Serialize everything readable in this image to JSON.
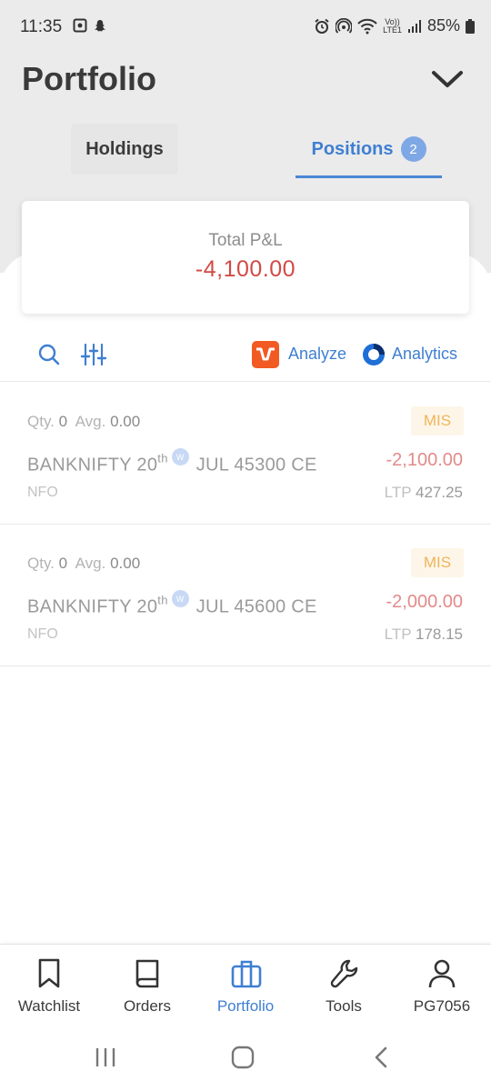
{
  "status_bar": {
    "time": "11:35",
    "battery": "85%",
    "network": "LTE1",
    "network_prefix": "Vo))"
  },
  "header": {
    "title": "Portfolio"
  },
  "tabs": {
    "holdings": "Holdings",
    "positions": "Positions",
    "positions_count": "2"
  },
  "summary": {
    "label": "Total P&L",
    "value": "-4,100.00"
  },
  "toolbar": {
    "analyze": "Analyze",
    "analytics": "Analytics"
  },
  "positions": [
    {
      "qty_label": "Qty.",
      "qty": "0",
      "avg_label": "Avg.",
      "avg": "0.00",
      "product": "MIS",
      "symbol": "BANKNIFTY 20",
      "sup": "th",
      "weekly": "W",
      "contract": "JUL 45300 CE",
      "pnl": "-2,100.00",
      "exchange": "NFO",
      "ltp_label": "LTP",
      "ltp": "427.25"
    },
    {
      "qty_label": "Qty.",
      "qty": "0",
      "avg_label": "Avg.",
      "avg": "0.00",
      "product": "MIS",
      "symbol": "BANKNIFTY 20",
      "sup": "th",
      "weekly": "W",
      "contract": "JUL 45600 CE",
      "pnl": "-2,000.00",
      "exchange": "NFO",
      "ltp_label": "LTP",
      "ltp": "178.15"
    }
  ],
  "bottom_nav": {
    "watchlist": "Watchlist",
    "orders": "Orders",
    "portfolio": "Portfolio",
    "tools": "Tools",
    "profile": "PG7056"
  },
  "colors": {
    "accent": "#3f7fd2",
    "loss": "#d14a45",
    "analyze_brand": "#f25a23",
    "mis": "#efb45c"
  },
  "icons": {
    "search": "search-icon",
    "filter": "sliders-icon",
    "chevron": "chevron-down-icon",
    "watchlist": "bookmark-icon",
    "orders": "book-icon",
    "portfolio": "briefcase-icon",
    "tools": "wrench-icon",
    "profile": "user-icon"
  }
}
